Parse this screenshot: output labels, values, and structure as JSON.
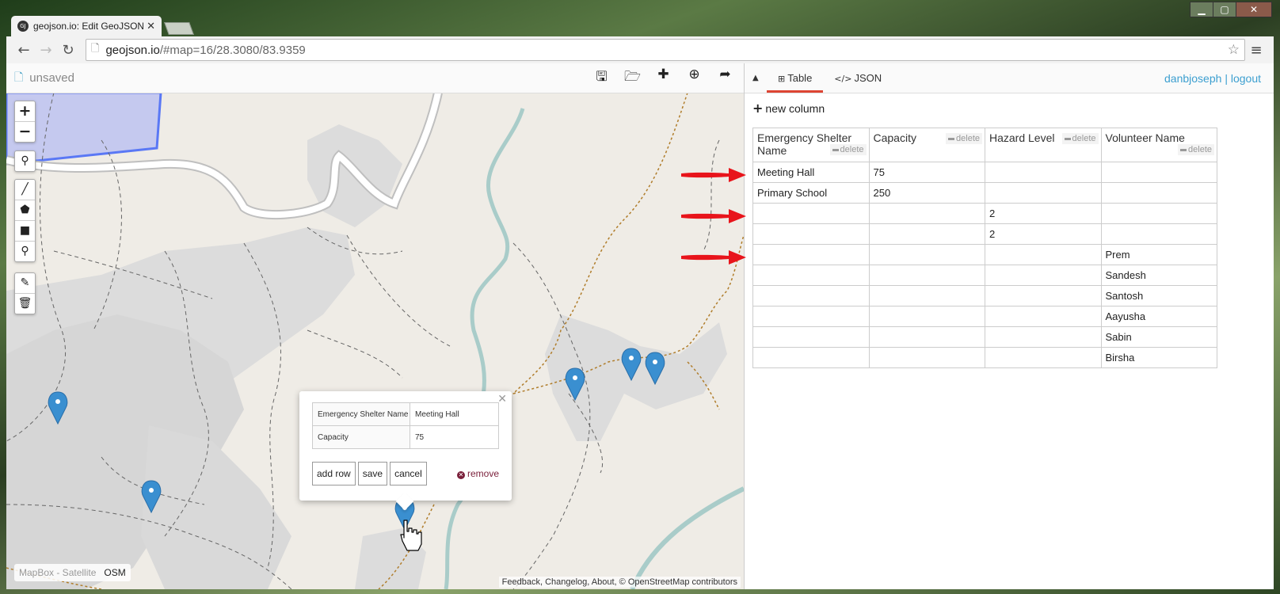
{
  "browser": {
    "tab_title": "geojson.io: Edit GeoJSON",
    "tab_favicon_text": "GJ",
    "url_host": "geojson.io",
    "url_path": "/#map=16/28.3080/83.9359",
    "window_controls": [
      "minimize",
      "maximize",
      "close"
    ]
  },
  "map_toolbar": {
    "file_name": "unsaved",
    "actions": [
      {
        "name": "save-icon",
        "glyph": "🖫"
      },
      {
        "name": "open-icon",
        "glyph": "🗁"
      },
      {
        "name": "new-icon",
        "glyph": "✚"
      },
      {
        "name": "download-icon",
        "glyph": "⊕"
      },
      {
        "name": "share-icon",
        "glyph": "➦"
      }
    ]
  },
  "map": {
    "zoom_in": "+",
    "zoom_out": "−",
    "layers": {
      "satellite": "MapBox - Satellite",
      "osm": "OSM"
    },
    "attribution": "Feedback, Changelog, About, © OpenStreetMap contributors"
  },
  "popup": {
    "rows": [
      {
        "key": "Emergency Shelter Name",
        "value": "Meeting Hall"
      },
      {
        "key": "Capacity",
        "value": "75"
      }
    ],
    "add_row": "add row",
    "save": "save",
    "cancel": "cancel",
    "remove": "remove"
  },
  "right_pane": {
    "tabs": {
      "table": "Table",
      "json": "JSON"
    },
    "user": "danbjoseph",
    "separator": "|",
    "logout": "logout",
    "new_column": "new column",
    "delete_label": "delete",
    "columns": [
      "Emergency Shelter Name",
      "Capacity",
      "Hazard Level",
      "Volunteer Name"
    ],
    "rows": [
      [
        "Meeting Hall",
        "75",
        "",
        ""
      ],
      [
        "Primary School",
        "250",
        "",
        ""
      ],
      [
        "",
        "",
        "2",
        ""
      ],
      [
        "",
        "",
        "2",
        ""
      ],
      [
        "",
        "",
        "",
        "Prem"
      ],
      [
        "",
        "",
        "",
        "Sandesh"
      ],
      [
        "",
        "",
        "",
        "Santosh"
      ],
      [
        "",
        "",
        "",
        "Aayusha"
      ],
      [
        "",
        "",
        "",
        " Sabin"
      ],
      [
        "",
        "",
        "",
        "Birsha"
      ]
    ]
  },
  "colors": {
    "accent_link": "#3c9fd0",
    "marker": "#3a8fd0",
    "annotation_arrow": "#e8141b",
    "polygon_fill": "#c5c9ef",
    "polygon_stroke": "#5a78f5"
  }
}
